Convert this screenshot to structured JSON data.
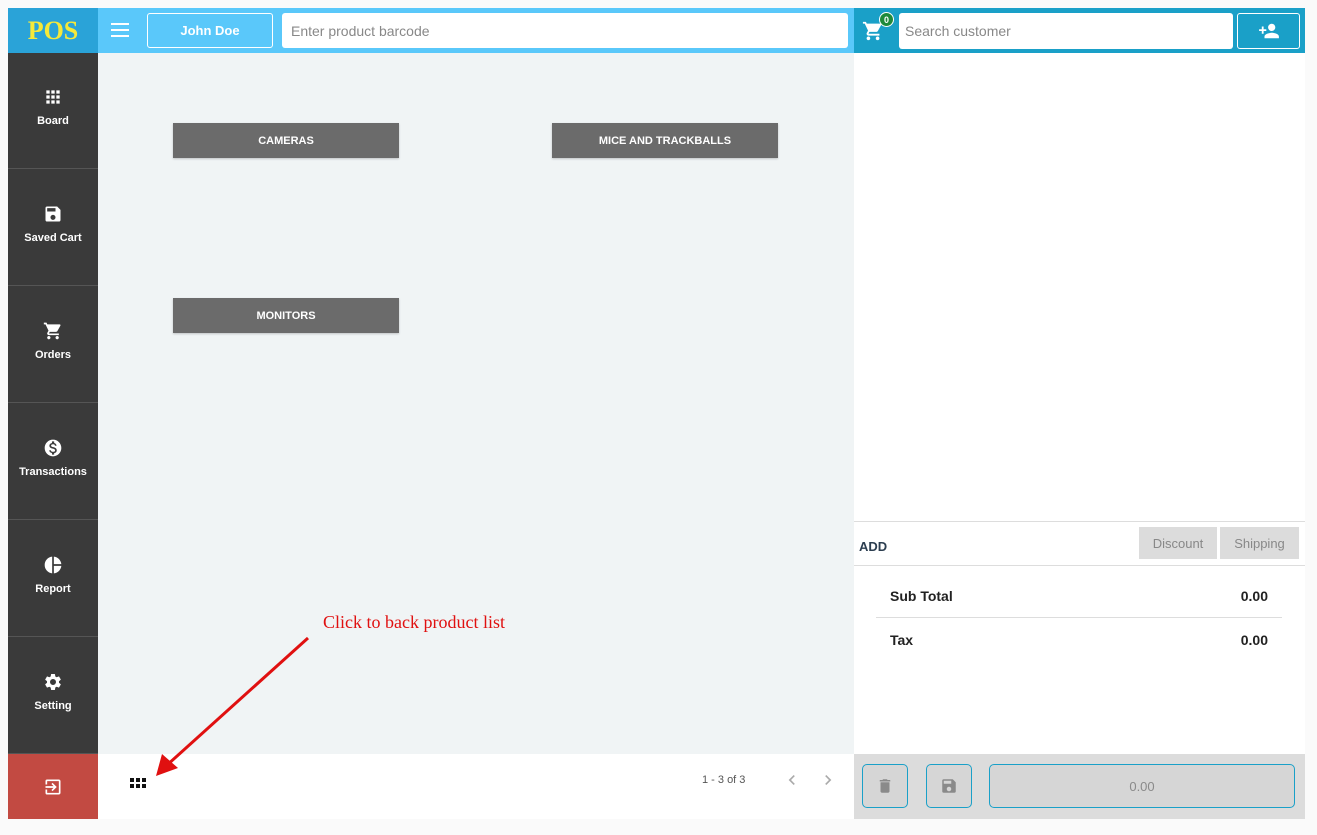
{
  "header": {
    "logo": "POS",
    "user_name": "John Doe",
    "barcode_placeholder": "Enter product barcode",
    "cart_count": "0",
    "customer_placeholder": "Search customer"
  },
  "sidebar": {
    "items": [
      {
        "label": "Board",
        "icon": "grid-icon"
      },
      {
        "label": "Saved Cart",
        "icon": "floppy-disk-icon"
      },
      {
        "label": "Orders",
        "icon": "cart-icon"
      },
      {
        "label": "Transactions",
        "icon": "dollar-icon"
      },
      {
        "label": "Report",
        "icon": "pie-chart-icon"
      },
      {
        "label": "Setting",
        "icon": "gear-icon"
      }
    ],
    "logout_icon": "logout-icon"
  },
  "categories": [
    {
      "label": "CAMERAS"
    },
    {
      "label": "MICE AND TRACKBALLS"
    },
    {
      "label": "MONITORS"
    }
  ],
  "pager": {
    "range_text": "1 - 3 of 3"
  },
  "annotation": {
    "text": "Click to back product list",
    "color": "#e01010"
  },
  "cart": {
    "add_label": "ADD",
    "discount_label": "Discount",
    "shipping_label": "Shipping",
    "subtotal_label": "Sub Total",
    "subtotal_value": "0.00",
    "tax_label": "Tax",
    "tax_value": "0.00",
    "pay_value": "0.00"
  },
  "colors": {
    "logo_bg": "#2aa3d8",
    "logo_text": "#f5e93a",
    "topbar": "#5ac8fa",
    "topbar_right": "#1aa0c8",
    "sidebar": "#3a3a3a",
    "logout": "#c24a42",
    "category": "#6b6b6b"
  }
}
